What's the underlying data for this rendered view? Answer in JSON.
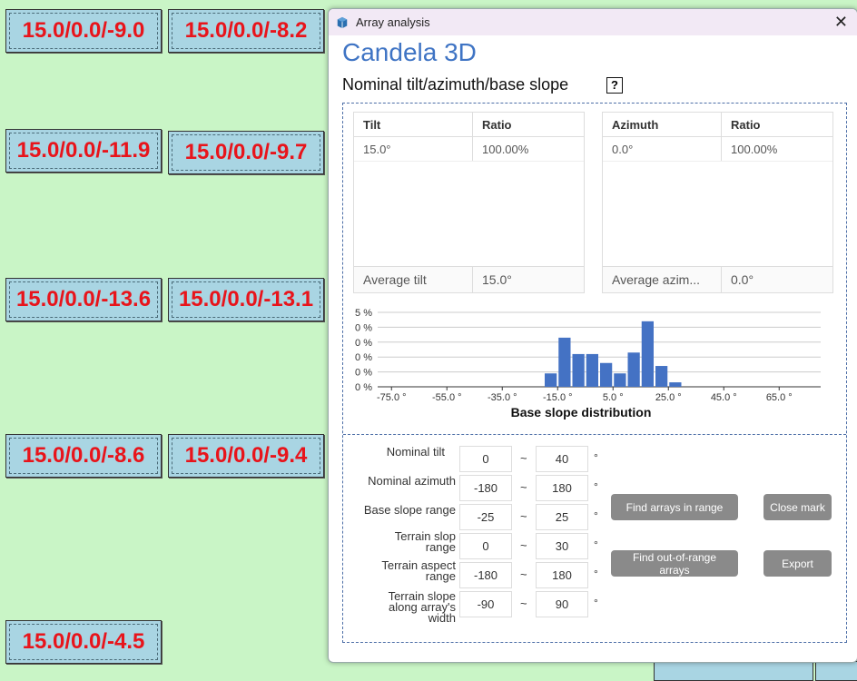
{
  "canvas": {
    "tiles": [
      "15.0/0.0/-9.0",
      "15.0/0.0/-8.2",
      "15.0/0.0/-11.9",
      "15.0/0.0/-9.7",
      "15.0/0.0/-13.6",
      "15.0/0.0/-13.1",
      "15.0/0.0/-8.6",
      "15.0/0.0/-9.4",
      "15.0/0.0/-4.5"
    ]
  },
  "dialog": {
    "title": "Array analysis",
    "close_glyph": "✕",
    "brand": "Candela 3D",
    "subtitle": "Nominal tilt/azimuth/base slope",
    "help_glyph": "?",
    "tilt_table": {
      "headers": [
        "Tilt",
        "Ratio"
      ],
      "rows": [
        [
          "15.0°",
          "100.00%"
        ]
      ],
      "footer": [
        "Average tilt",
        "15.0°"
      ]
    },
    "azimuth_table": {
      "headers": [
        "Azimuth",
        "Ratio"
      ],
      "rows": [
        [
          "0.0°",
          "100.00%"
        ]
      ],
      "footer": [
        "Average azim...",
        "0.0°"
      ]
    },
    "form": {
      "nominal_tilt": {
        "label": "Nominal tilt",
        "min": "0",
        "max": "40"
      },
      "nominal_azimuth": {
        "label": "Nominal azimuth",
        "min": "-180",
        "max": "180"
      },
      "base_slope_range": {
        "label": "Base slope range",
        "min": "-25",
        "max": "25"
      },
      "terrain_slop_range": {
        "label_line1": "Terrain slop",
        "label_line2": "range",
        "min": "0",
        "max": "30"
      },
      "terrain_aspect_range": {
        "label_line1": "Terrain aspect",
        "label_line2": "range",
        "min": "-180",
        "max": "180"
      },
      "terrain_slope_along": {
        "label_line1": "Terrain slope",
        "label_line2": "along array's",
        "label_line3": "width",
        "min": "-90",
        "max": "90"
      },
      "tilde": "~",
      "degree": "°"
    },
    "buttons": {
      "find_in_range": "Find arrays in range",
      "close_mark": "Close mark",
      "find_out_of_range": "Find out-of-range arrays",
      "export": "Export"
    }
  },
  "chart_data": {
    "type": "bar",
    "title": "Base slope distribution",
    "bar_color": "#4472c4",
    "ytick_labels": [
      "5 %",
      "0 %",
      "0 %",
      "0 %",
      "0 %",
      "0 %"
    ],
    "yticks_unit": "%",
    "ylim": [
      0,
      5
    ],
    "xticks": [
      -75,
      -55,
      -35,
      -15,
      5,
      25,
      45,
      65
    ],
    "xtick_labels": [
      "-75.0 °",
      "-55.0 °",
      "-35.0 °",
      "-15.0 °",
      "5.0 °",
      "25.0 °",
      "45.0 °",
      "65.0 °"
    ],
    "xlim": [
      -80,
      80
    ],
    "bin_width": 5,
    "bins": [
      {
        "x": -17.5,
        "value": 0.9
      },
      {
        "x": -12.5,
        "value": 3.3
      },
      {
        "x": -7.5,
        "value": 2.2
      },
      {
        "x": -2.5,
        "value": 2.2
      },
      {
        "x": 2.5,
        "value": 1.6
      },
      {
        "x": 7.5,
        "value": 0.9
      },
      {
        "x": 12.5,
        "value": 2.3
      },
      {
        "x": 17.5,
        "value": 4.4
      },
      {
        "x": 22.5,
        "value": 1.4
      },
      {
        "x": 27.5,
        "value": 0.3
      }
    ]
  }
}
